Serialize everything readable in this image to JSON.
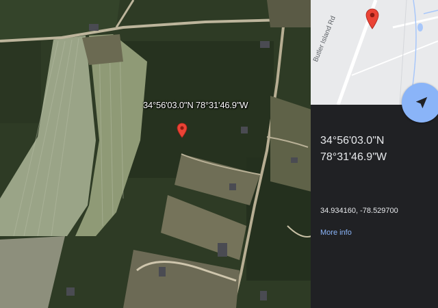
{
  "map": {
    "marker_label": "34°56'03.0\"N 78°31'46.9\"W",
    "marker_icon": "red-location-pin-icon"
  },
  "panel": {
    "mini_map": {
      "road_label": "Butler Island Rd",
      "pin_icon": "red-location-pin-icon"
    },
    "directions_icon": "navigation-arrow-icon",
    "latitude_dms": "34°56'03.0\"N",
    "longitude_dms": "78°31'46.9\"W",
    "decimal_coords": "34.934160, -78.529700",
    "more_info_label": "More info"
  },
  "colors": {
    "pin": "#ea4335",
    "panel_bg": "#202124",
    "accent_blue": "#8ab4f8",
    "mini_map_bg": "#e8eaed"
  }
}
